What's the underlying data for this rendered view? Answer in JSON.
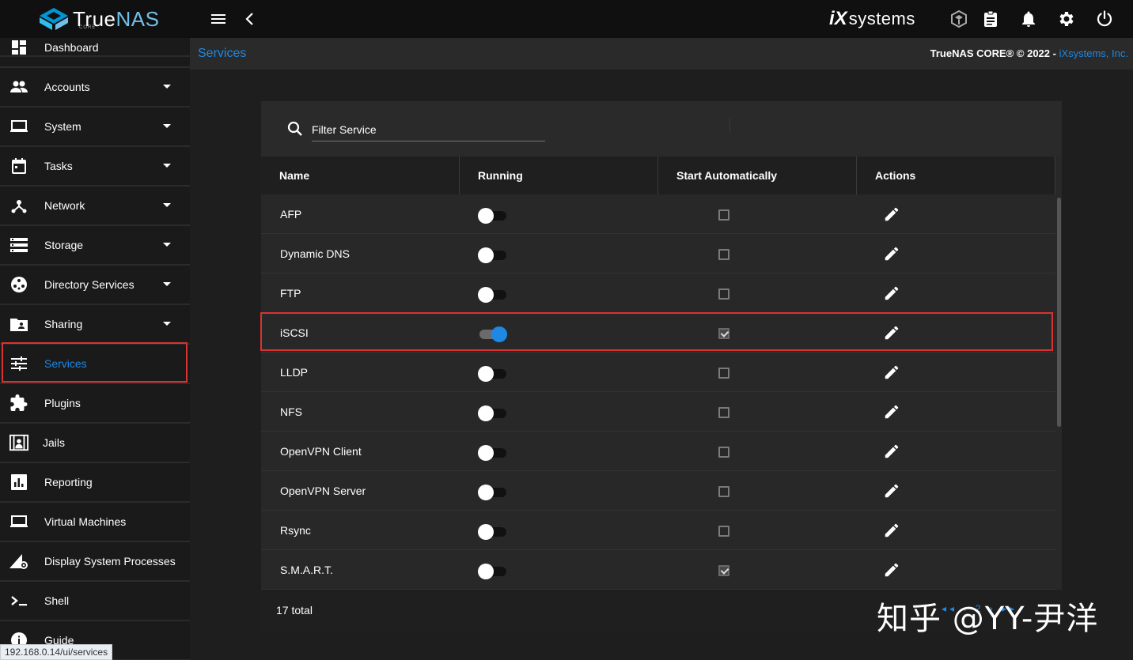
{
  "app": {
    "logo_text_true": "True",
    "logo_text_nas": "NAS",
    "logo_sub": "CORE",
    "vendor_ix": "iX",
    "vendor_systems": "systems"
  },
  "icons": {
    "menu": "hamburger-menu-icon",
    "back": "chevron-left-icon",
    "truecommand": "truecommand-cube-icon",
    "tasks": "clipboard-icon",
    "alerts": "bell-icon",
    "settings": "gear-icon",
    "power": "power-icon"
  },
  "sidebar": {
    "items": [
      {
        "label": "Dashboard",
        "icon": "dashboard-icon",
        "has_submenu": false
      },
      {
        "label": "Accounts",
        "icon": "people-icon",
        "has_submenu": true
      },
      {
        "label": "System",
        "icon": "laptop-icon",
        "has_submenu": true
      },
      {
        "label": "Tasks",
        "icon": "calendar-icon",
        "has_submenu": true
      },
      {
        "label": "Network",
        "icon": "network-icon",
        "has_submenu": true
      },
      {
        "label": "Storage",
        "icon": "storage-icon",
        "has_submenu": true
      },
      {
        "label": "Directory Services",
        "icon": "directory-icon",
        "has_submenu": true
      },
      {
        "label": "Sharing",
        "icon": "folder-shared-icon",
        "has_submenu": true
      },
      {
        "label": "Services",
        "icon": "tune-icon",
        "has_submenu": false,
        "active": true
      },
      {
        "label": "Plugins",
        "icon": "puzzle-icon",
        "has_submenu": false
      },
      {
        "label": "Jails",
        "icon": "jail-icon",
        "has_submenu": false
      },
      {
        "label": "Reporting",
        "icon": "chart-icon",
        "has_submenu": false
      },
      {
        "label": "Virtual Machines",
        "icon": "monitor-icon",
        "has_submenu": false
      },
      {
        "label": "Display System Processes",
        "icon": "processes-icon",
        "has_submenu": false
      },
      {
        "label": "Shell",
        "icon": "terminal-icon",
        "has_submenu": false
      },
      {
        "label": "Guide",
        "icon": "info-icon",
        "has_submenu": false
      }
    ]
  },
  "page": {
    "breadcrumb": "Services",
    "copyright_text": "TrueNAS CORE® © 2022 - ",
    "copyright_link": "iXsystems, Inc."
  },
  "services_table": {
    "filter_placeholder": "Filter Service",
    "columns": [
      "Name",
      "Running",
      "Start Automatically",
      "Actions"
    ],
    "rows": [
      {
        "name": "AFP",
        "running": false,
        "start_auto": false
      },
      {
        "name": "Dynamic DNS",
        "running": false,
        "start_auto": false
      },
      {
        "name": "FTP",
        "running": false,
        "start_auto": false
      },
      {
        "name": "iSCSI",
        "running": true,
        "start_auto": true
      },
      {
        "name": "LLDP",
        "running": false,
        "start_auto": false
      },
      {
        "name": "NFS",
        "running": false,
        "start_auto": false
      },
      {
        "name": "OpenVPN Client",
        "running": false,
        "start_auto": false
      },
      {
        "name": "OpenVPN Server",
        "running": false,
        "start_auto": false
      },
      {
        "name": "Rsync",
        "running": false,
        "start_auto": false
      },
      {
        "name": "S.M.A.R.T.",
        "running": false,
        "start_auto": true
      }
    ],
    "total_label": "17 total"
  },
  "watermark": "知乎 @YY-尹洋",
  "status_url": "192.168.0.14/ui/services",
  "colors": {
    "accent": "#1e88e5",
    "highlight_outline": "#d93232"
  }
}
